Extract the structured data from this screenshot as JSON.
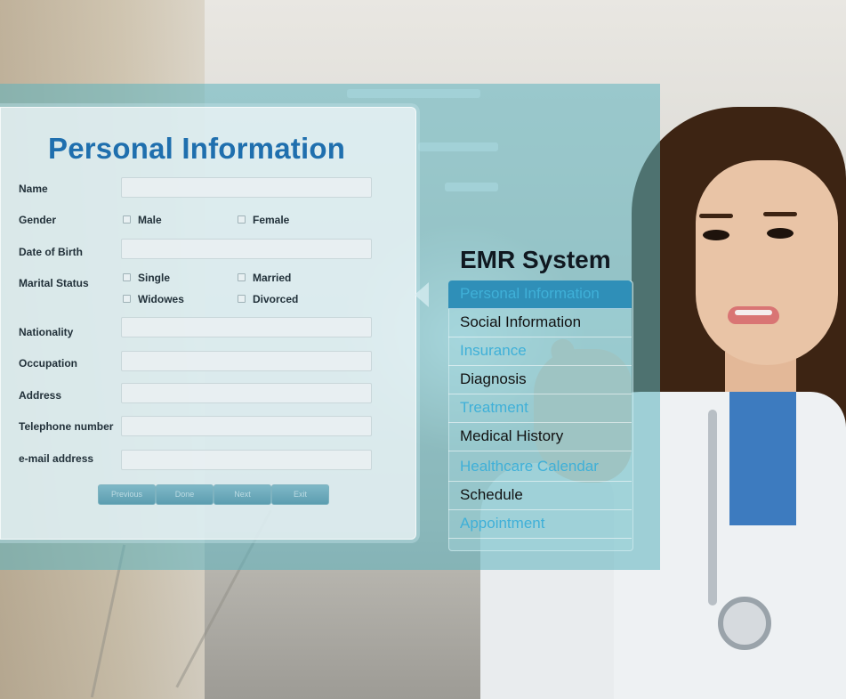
{
  "form": {
    "title": "Personal Information",
    "labels": {
      "name": "Name",
      "gender": "Gender",
      "dob": "Date of Birth",
      "marital": "Marital Status",
      "nationality": "Nationality",
      "occupation": "Occupation",
      "address": "Address",
      "telephone": "Telephone number",
      "email": "e-mail address"
    },
    "gender_options": [
      "Male",
      "Female"
    ],
    "marital_options": [
      "Single",
      "Married",
      "Widowes",
      "Divorced"
    ],
    "buttons": [
      "Previous",
      "Done",
      "Next",
      "Exit"
    ]
  },
  "emr": {
    "title": "EMR System",
    "items": [
      {
        "label": "Personal Information",
        "color": "#3fb0d8"
      },
      {
        "label": "Social Information",
        "color": "#111111"
      },
      {
        "label": "Insurance",
        "color": "#3fb0d8"
      },
      {
        "label": "Diagnosis",
        "color": "#111111"
      },
      {
        "label": "Treatment",
        "color": "#3fb0d8"
      },
      {
        "label": "Medical History",
        "color": "#111111"
      },
      {
        "label": "Healthcare Calendar",
        "color": "#3fb0d8"
      },
      {
        "label": "Schedule",
        "color": "#111111"
      },
      {
        "label": "Appointment",
        "color": "#3fb0d8"
      }
    ],
    "active_index": 0
  },
  "colors": {
    "title_blue": "#1f6fae",
    "accent": "#2f8fb8"
  }
}
